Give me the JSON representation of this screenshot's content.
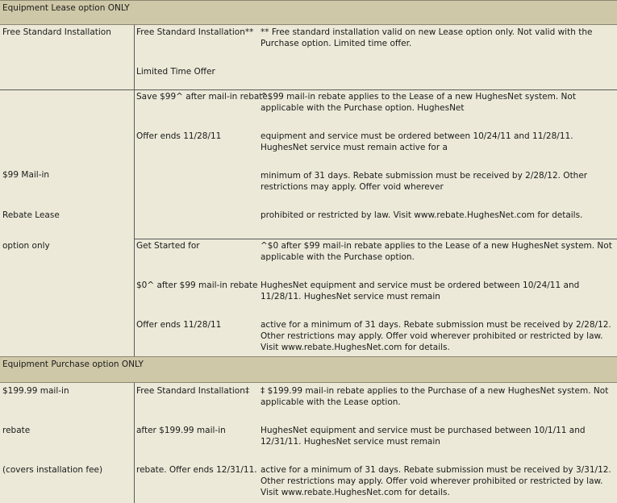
{
  "sections": {
    "lease_header": "Equipment Lease option ONLY",
    "purchase_header": "Equipment Purchase option ONLY"
  },
  "install_row": {
    "col1": "Free Standard Installation",
    "col2_line1": "Free Standard Installation**",
    "col2_line2": "Limited Time Offer",
    "col3": "** Free standard installation valid on new Lease option only. Not valid with the Purchase option. Limited time offer."
  },
  "lease_rebate": {
    "col1_line1": "$99 Mail-in",
    "col1_line2": "Rebate Lease",
    "col1_line3": "option only",
    "offer1": {
      "col2_line1": "Save $99^ after mail-in rebate.",
      "col2_line2": "Offer ends 11/28/11",
      "col3_p1": "^$99 mail-in rebate applies to the Lease of a new HughesNet system. Not applicable with the Purchase option. HughesNet",
      "col3_p2": "equipment and service must be ordered between 10/24/11 and 11/28/11. HughesNet service must remain active for a",
      "col3_p3": "minimum of 31 days. Rebate submission must be received by 2/28/12. Other restrictions may apply. Offer void wherever",
      "col3_p4": "prohibited or restricted by law. Visit www.rebate.HughesNet.com for details."
    },
    "offer2": {
      "col2_line1": "Get Started for",
      "col2_line2": "$0^ after $99 mail-in rebate",
      "col2_line3": "Offer ends 11/28/11",
      "col3_p1": "^$0 after $99 mail-in rebate applies to the Lease of a new HughesNet system. Not applicable with the Purchase option.",
      "col3_p2": "HughesNet equipment and service must be ordered between 10/24/11 and 11/28/11. HughesNet service must remain",
      "col3_p3": "active for a minimum of 31 days. Rebate submission must be received by 2/28/12. Other restrictions may apply. Offer void wherever prohibited or restricted by law. Visit www.rebate.HughesNet.com for details."
    }
  },
  "purchase_rebate": {
    "col1_line1": "$199.99 mail-in",
    "col1_line2": "rebate",
    "col1_line3": "(covers installation fee)",
    "col2_line1": "Free Standard Installation‡",
    "col2_line2": "after $199.99 mail-in",
    "col2_line3": "rebate. Offer ends 12/31/11.",
    "col3_p1": "‡ $199.99 mail-in rebate applies to the Purchase of a new HughesNet system. Not applicable with the Lease option.",
    "col3_p2": "HughesNet equipment and service must be purchased between 10/1/11 and 12/31/11. HughesNet service must remain",
    "col3_p3": "active for a minimum of 31 days. Rebate submission must be received by 3/31/12. Other restrictions may apply. Offer void wherever prohibited or restricted by law. Visit www.rebate.HughesNet.com for details."
  }
}
